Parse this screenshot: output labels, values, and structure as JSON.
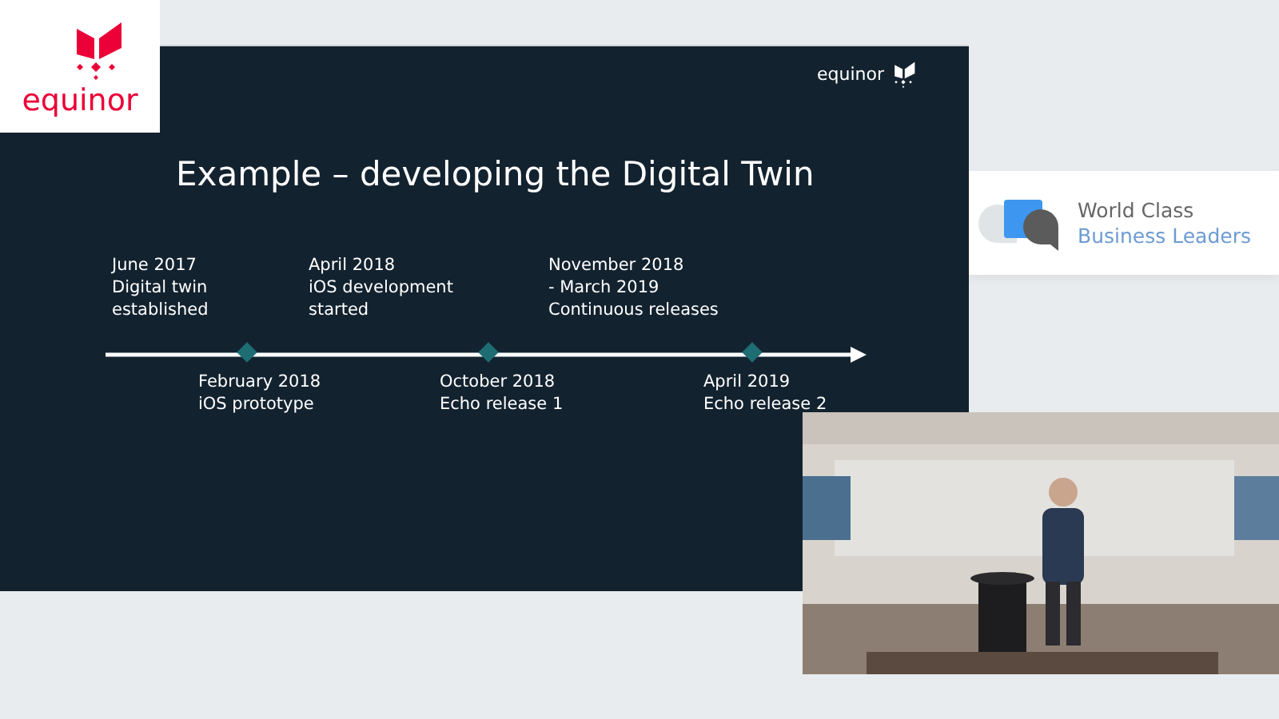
{
  "corner_logo": {
    "wordmark": "equinor"
  },
  "slide": {
    "logo": "equinor",
    "title": "Example – developing the Digital Twin",
    "milestones": [
      {
        "kind": "above",
        "lines": [
          "June 2017",
          "Digital twin",
          "established"
        ]
      },
      {
        "kind": "below",
        "lines": [
          "February 2018",
          "iOS prototype"
        ]
      },
      {
        "kind": "above",
        "lines": [
          "April 2018",
          "iOS development",
          "started"
        ]
      },
      {
        "kind": "below",
        "lines": [
          "October 2018",
          "Echo release 1"
        ]
      },
      {
        "kind": "above",
        "lines": [
          "November 2018",
          "- March 2019",
          "Continuous releases"
        ]
      },
      {
        "kind": "below",
        "lines": [
          "April 2019",
          "Echo release 2"
        ]
      }
    ]
  },
  "sponsor_card": {
    "line_1": "World Class",
    "line_2": "Business Leaders"
  }
}
